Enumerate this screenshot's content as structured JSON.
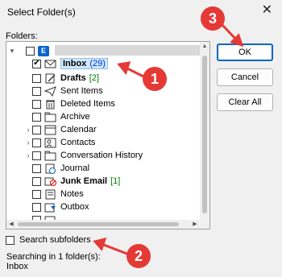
{
  "dialog": {
    "title": "Select Folder(s)",
    "close_glyph": "✕",
    "folders_label": "Folders:"
  },
  "tree": {
    "items": [
      {
        "label": "Inbox",
        "count": "(29)",
        "count_color": "blue",
        "bold": true,
        "checked": true,
        "selected": true,
        "icon": "envelope-icon"
      },
      {
        "label": "Drafts",
        "count": "[2]",
        "count_color": "green",
        "bold": true,
        "checked": false,
        "icon": "drafts-icon"
      },
      {
        "label": "Sent Items",
        "count": "",
        "bold": false,
        "checked": false,
        "icon": "sent-icon"
      },
      {
        "label": "Deleted Items",
        "count": "",
        "bold": false,
        "checked": false,
        "icon": "trash-icon"
      },
      {
        "label": "Archive",
        "count": "",
        "bold": false,
        "checked": false,
        "icon": "folder-icon"
      },
      {
        "label": "Calendar",
        "count": "",
        "bold": false,
        "checked": false,
        "icon": "calendar-icon",
        "expander": true
      },
      {
        "label": "Contacts",
        "count": "",
        "bold": false,
        "checked": false,
        "icon": "contacts-icon",
        "expander": true
      },
      {
        "label": "Conversation History",
        "count": "",
        "bold": false,
        "checked": false,
        "icon": "folder-icon",
        "expander": true
      },
      {
        "label": "Journal",
        "count": "",
        "bold": false,
        "checked": false,
        "icon": "journal-icon"
      },
      {
        "label": "Junk Email",
        "count": "[1]",
        "count_color": "green",
        "bold": true,
        "checked": false,
        "icon": "junk-icon"
      },
      {
        "label": "Notes",
        "count": "",
        "bold": false,
        "checked": false,
        "icon": "notes-icon"
      },
      {
        "label": "Outbox",
        "count": "",
        "bold": false,
        "checked": false,
        "icon": "outbox-icon"
      }
    ]
  },
  "buttons": {
    "ok": "OK",
    "cancel": "Cancel",
    "clear_all": "Clear All"
  },
  "search_subfolders_label": "Search subfolders",
  "status": {
    "line1": "Searching in 1 folder(s):",
    "line2": "Inbox"
  },
  "annotations": {
    "badge_1": "1",
    "badge_2": "2",
    "badge_3": "3",
    "color": "#e53935"
  },
  "colors": {
    "ok_border": "#0067c0",
    "selection": "#cce8ff",
    "count_blue": "#0033cc",
    "count_green": "#008000",
    "outlook_blue": "#0a64c8"
  }
}
